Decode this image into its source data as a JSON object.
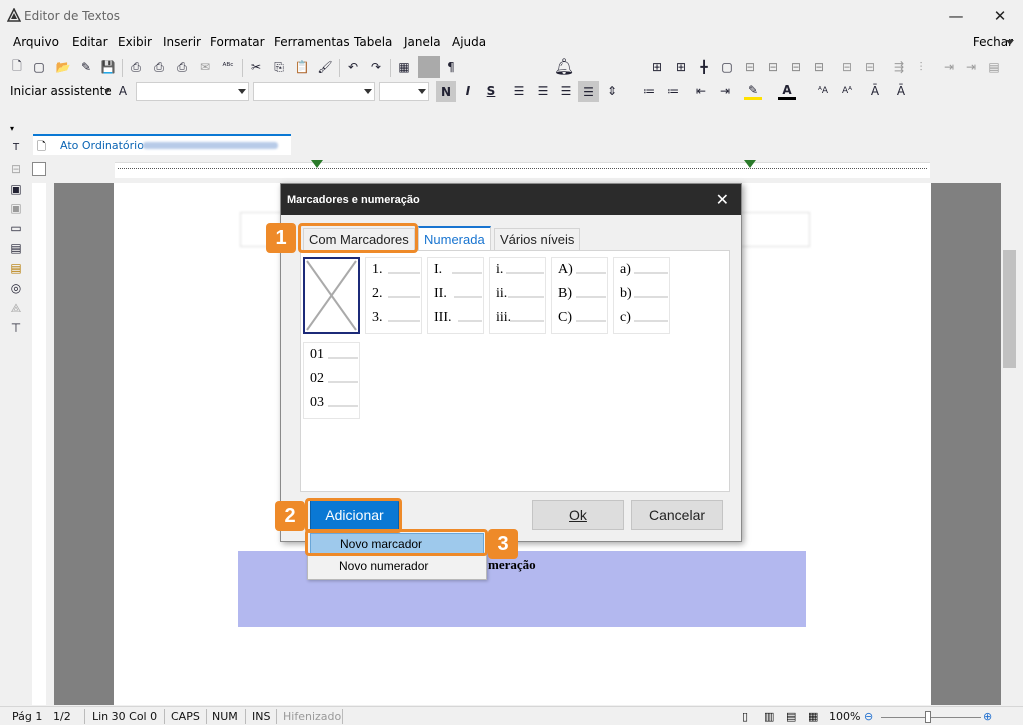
{
  "window": {
    "title": "Editor de Textos",
    "icons": {
      "app": "app-logo-icon",
      "minimize": "minimize-icon",
      "maximize": "maximize-icon",
      "close": "close-icon"
    }
  },
  "menu": {
    "items": [
      "Arquivo",
      "Editar",
      "Exibir",
      "Inserir",
      "Formatar",
      "Ferramentas",
      "Tabela",
      "Janela",
      "Ajuda"
    ],
    "fechar": "Fechar"
  },
  "toolbar2": {
    "assistant": "Iniciar assistente",
    "bold": "N",
    "italic": "I",
    "underline": "S"
  },
  "document": {
    "tab_label": "Ato Ordinatório",
    "heading_fragment": "meração"
  },
  "dialog": {
    "title": "Marcadores e numeração",
    "tabs": [
      "Com Marcadores",
      "Numerada",
      "Vários níveis"
    ],
    "active_tab": "Numerada",
    "styles": [
      {
        "lines": [
          "1.",
          "2.",
          "3."
        ]
      },
      {
        "lines": [
          "I.",
          "II.",
          "III."
        ]
      },
      {
        "lines": [
          "i.",
          "ii.",
          "iii."
        ]
      },
      {
        "lines": [
          "A)",
          "B)",
          "C)"
        ]
      },
      {
        "lines": [
          "a)",
          "b)",
          "c)"
        ]
      },
      {
        "lines": [
          "01",
          "02",
          "03"
        ]
      }
    ],
    "buttons": {
      "add": "Adicionar",
      "ok": "Ok",
      "cancel": "Cancelar"
    },
    "popup": [
      "Novo marcador",
      "Novo numerador"
    ]
  },
  "callouts": [
    "1",
    "2",
    "3"
  ],
  "colors": {
    "accent": "#0a78d4",
    "callout": "#ee8a29",
    "selection": "#b3b8ef"
  },
  "status": {
    "page": "Pág 1",
    "of": "1/2",
    "position": "Lin 30  Col 0",
    "caps": "CAPS",
    "num": "NUM",
    "ins": "INS",
    "hyphen": "Hifenizado",
    "zoom": "100%"
  }
}
